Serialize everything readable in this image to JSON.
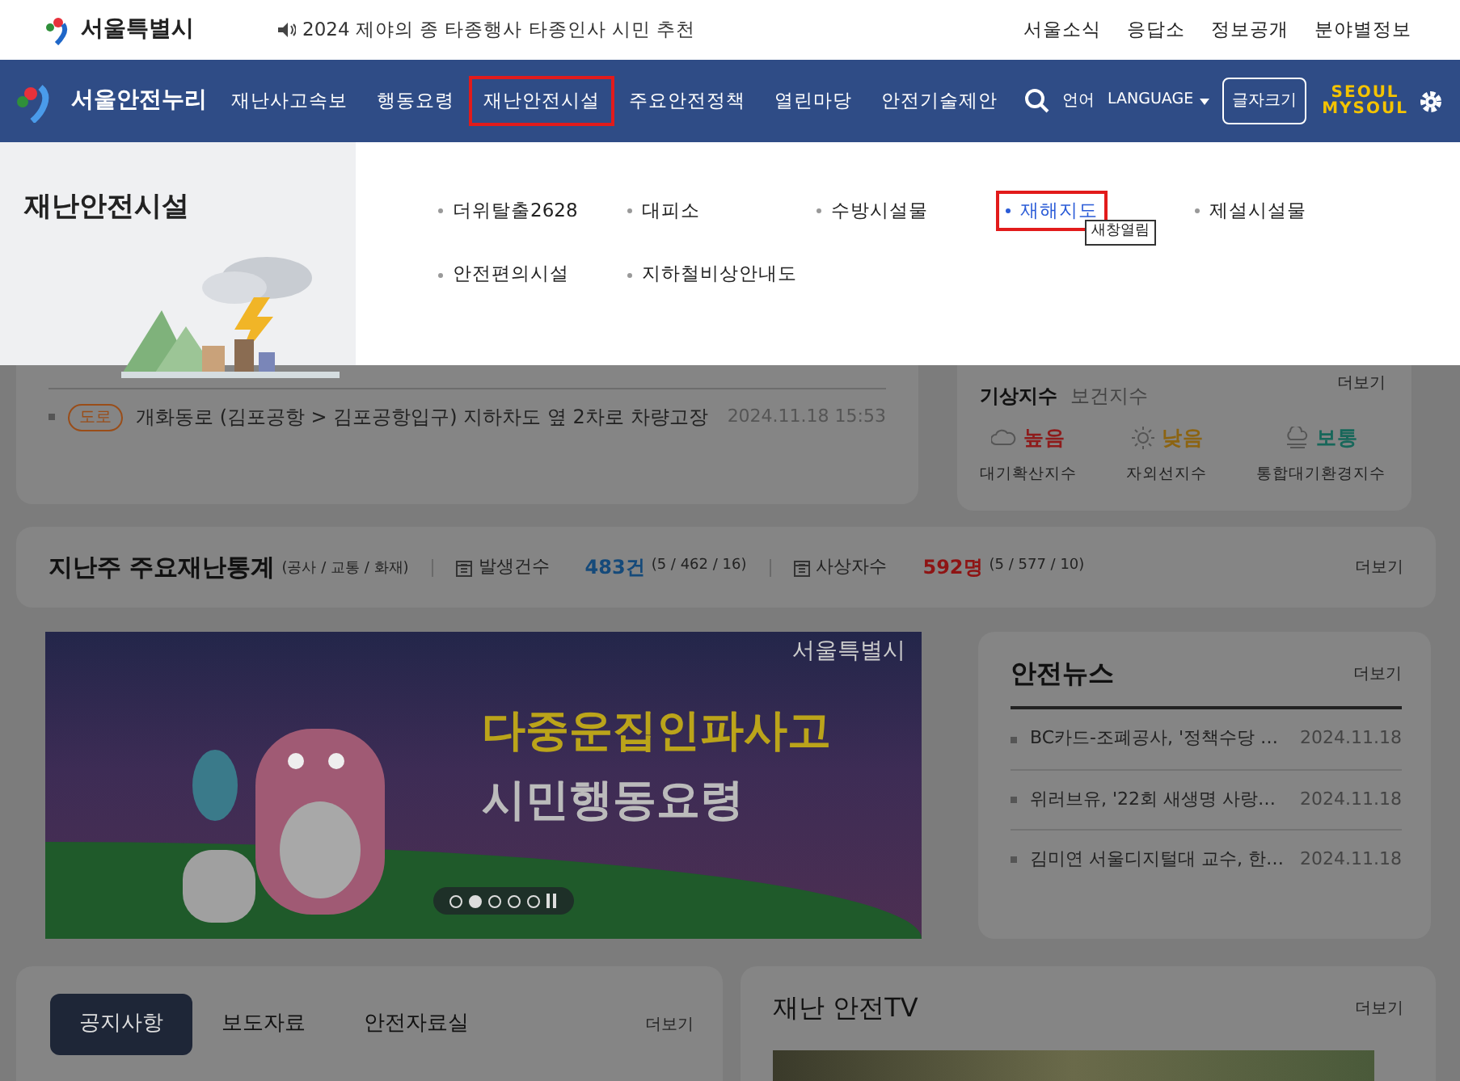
{
  "top_bar": {
    "logo": "서울특별시",
    "notice": "2024 제야의 종 타종행사 타종인사 시민 추천",
    "links": [
      "서울소식",
      "응답소",
      "정보공개",
      "분야별정보"
    ]
  },
  "nav": {
    "logo": "서울안전누리",
    "menu": [
      {
        "label": "재난사고속보",
        "selected": false
      },
      {
        "label": "행동요령",
        "selected": false
      },
      {
        "label": "재난안전시설",
        "selected": true
      },
      {
        "label": "주요안전정책",
        "selected": false
      },
      {
        "label": "열린마당",
        "selected": false
      },
      {
        "label": "안전기술제안",
        "selected": false
      }
    ],
    "language_label": "언어",
    "language": "LANGUAGE",
    "font_size_button": "글자크기",
    "brand_logo": [
      "SEOUL",
      "MYSOUL"
    ]
  },
  "dropdown": {
    "title": "재난안전시설",
    "tooltip": "새창열림",
    "items": [
      {
        "label": "더위탈출2628",
        "selected": false
      },
      {
        "label": "대피소",
        "selected": false
      },
      {
        "label": "수방시설물",
        "selected": false
      },
      {
        "label": "재해지도",
        "selected": true
      },
      {
        "label": "제설시설물",
        "selected": false
      },
      {
        "label": "안전편의시설",
        "selected": false
      },
      {
        "label": "지하철비상안내도",
        "selected": false
      }
    ]
  },
  "incidents": {
    "rows": [
      {
        "tag": "도로",
        "text": "개화동로 (김포공항 > 김포공항입구) 지하차도 옆 2차로 차량고장",
        "time": "2024.11.18 15:53"
      }
    ]
  },
  "indices": {
    "more": "더보기",
    "tabs": [
      {
        "label": "기상지수",
        "selected": true
      },
      {
        "label": "보건지수",
        "selected": false
      }
    ],
    "items": [
      {
        "kind": "cloud",
        "status": "높음",
        "color": "#8e1b1b",
        "name": "대기확산지수"
      },
      {
        "kind": "sun",
        "status": "낮음",
        "color": "#8c6412",
        "name": "자외선지수"
      },
      {
        "kind": "haze",
        "status": "보통",
        "color": "#17675a",
        "name": "통합대기환경지수"
      }
    ]
  },
  "stats": {
    "title": "지난주 주요재난통계",
    "subtitle": "(공사 / 교통 / 화재)",
    "more": "더보기",
    "groups": [
      {
        "label": "발생건수",
        "value": "483건",
        "detail": "(5 / 462 / 16)",
        "color": "#154a7a"
      },
      {
        "label": "사상자수",
        "value": "592명",
        "detail": "(5 / 577 / 10)",
        "color": "#8e1414"
      }
    ]
  },
  "banner": {
    "org": "서울특별시",
    "headline": "다중운집인파사고",
    "subline": "시민행동요령",
    "dots": [
      {
        "selected": false
      },
      {
        "selected": true
      },
      {
        "selected": false
      },
      {
        "selected": false
      },
      {
        "selected": false
      }
    ]
  },
  "news": {
    "title": "안전뉴스",
    "more": "더보기",
    "items": [
      {
        "title": "BC카드-조폐공사, '정책수당 …",
        "date": "2024.11.18"
      },
      {
        "title": "위러브유, '22회 새생명 사랑…",
        "date": "2024.11.18"
      },
      {
        "title": "김미연 서울디지털대 교수, 한…",
        "date": "2024.11.18"
      }
    ]
  },
  "notices": {
    "more": "더보기",
    "tabs": [
      {
        "label": "공지사항",
        "selected": true
      },
      {
        "label": "보도자료",
        "selected": false
      },
      {
        "label": "안전자료실",
        "selected": false
      }
    ]
  },
  "tv": {
    "title": "재난 안전TV",
    "more": "더보기"
  }
}
